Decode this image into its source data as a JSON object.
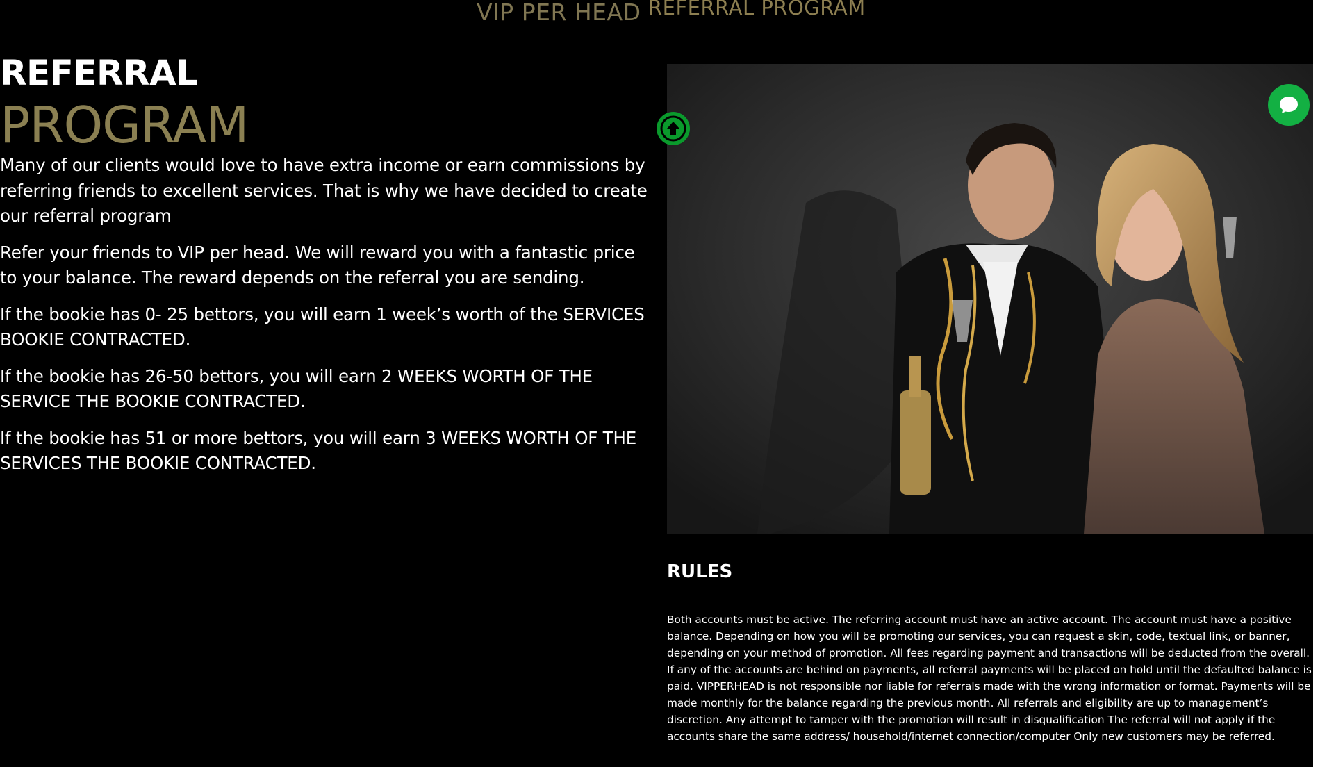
{
  "nav": {
    "vip_label": "VIP PER HEAD",
    "referral_label": "REFERRAL PROGRAM"
  },
  "hero": {
    "title_line1": "REFERRAL",
    "title_line2": "PROGRAM",
    "paragraphs": [
      "Many of our clients would love to have extra income or earn commissions by referring friends to excellent services. That is why we have decided to create our referral program",
      "Refer your friends to VIP per head. We will reward you with a fantastic price to your balance. The reward depends on the referral you are sending.",
      "If the bookie has 0- 25 bettors, you will earn 1 week’s worth of the SERVICES BOOKIE CONTRACTED.",
      "If the bookie has 26-50 bettors, you will earn 2 WEEKS WORTH OF THE SERVICE THE BOOKIE CONTRACTED.",
      "If the bookie has 51 or more bettors, you will earn 3 WEEKS WORTH OF THE SERVICES THE BOOKIE CONTRACTED."
    ]
  },
  "rules": {
    "title": "RULES",
    "body": "Both accounts must be active. The referring account must have an active account. The account must have a positive balance. Depending on how you will be promoting our services, you can request a skin, code, textual link, or banner, depending on your method of promotion. All fees regarding payment and transactions will be deducted from the overall. If any of the accounts are behind on payments, all referral payments will be placed on hold until the defaulted balance is paid. VIPPERHEAD is not responsible nor liable for referrals made with the wrong information or format. Payments will be made monthly for the balance regarding the previous month. All referrals and eligibility are up to management’s discretion. Any attempt to tamper with the promotion will result in disqualification The referral will not apply if the accounts share the same address/ household/internet connection/computer Only new customers may be referred."
  },
  "icons": {
    "scroll_top": "arrow-up-icon",
    "chat": "chat-bubble-icon"
  },
  "colors": {
    "gold": "#8b8052",
    "background": "#000000",
    "green": "#0a9a2c"
  }
}
